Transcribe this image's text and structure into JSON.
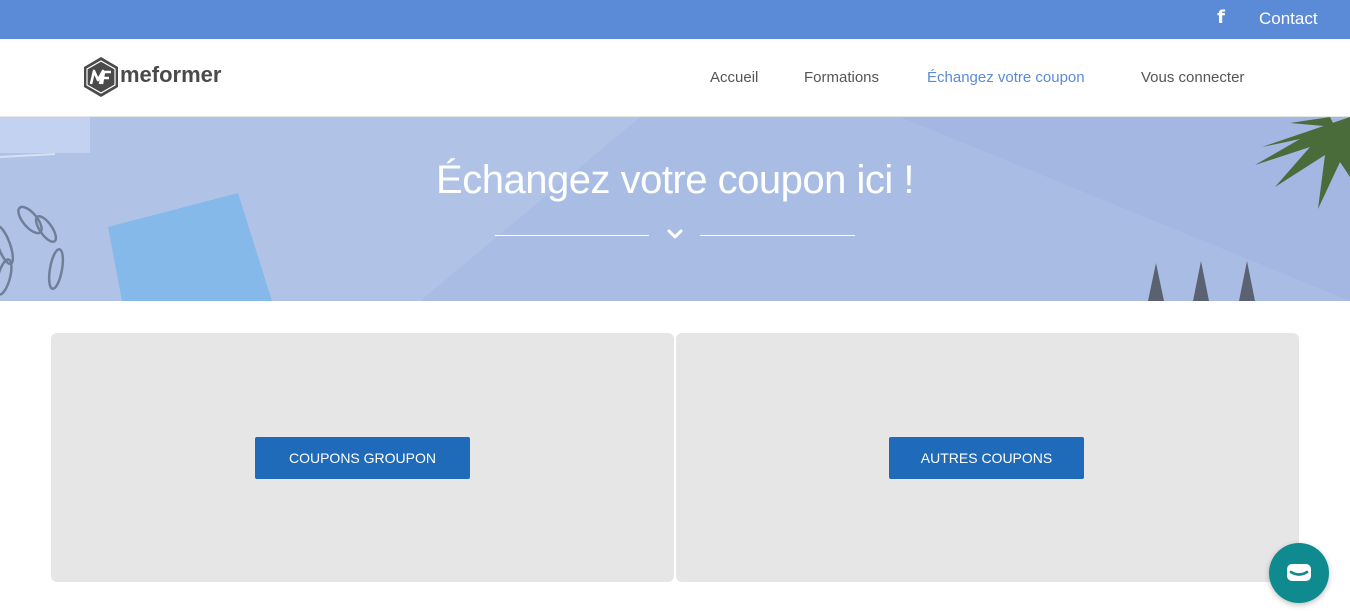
{
  "topbar": {
    "facebook_icon": "facebook-icon",
    "contact_label": "Contact"
  },
  "logo": {
    "mark_text": "MF",
    "text": "meformer"
  },
  "nav": {
    "items": [
      {
        "label": "Accueil",
        "active": false
      },
      {
        "label": "Formations",
        "active": false
      },
      {
        "label": "Échangez votre coupon",
        "active": true
      },
      {
        "label": "Vous connecter",
        "active": false
      }
    ]
  },
  "hero": {
    "title": "Échangez votre coupon ici !"
  },
  "panels": [
    {
      "button_label": "COUPONS GROUPON"
    },
    {
      "button_label": "AUTRES COUPONS"
    }
  ],
  "chat": {
    "icon": "chat-icon"
  },
  "colors": {
    "topbar": "#5b8bd6",
    "accent": "#5b8bd6",
    "button": "#1f6bb9",
    "panel": "#e6e6e6",
    "chat": "#0f8a8f",
    "hero": "#a9bde4"
  }
}
